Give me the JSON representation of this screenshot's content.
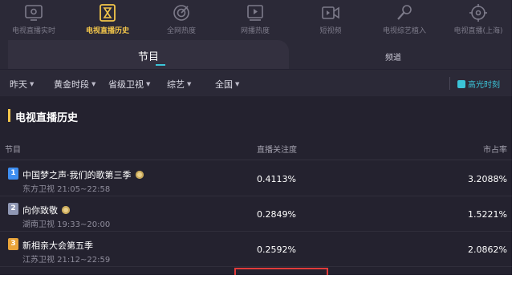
{
  "nav": {
    "items": [
      {
        "label": "电视直播实时",
        "icon": "tv-icon"
      },
      {
        "label": "电视直播历史",
        "icon": "hourglass-icon",
        "active": true
      },
      {
        "label": "全网热度",
        "icon": "target-icon"
      },
      {
        "label": "网播热度",
        "icon": "web-player-icon"
      },
      {
        "label": "短视频",
        "icon": "video-icon"
      },
      {
        "label": "电视综艺植入",
        "icon": "microphone-icon"
      },
      {
        "label": "电视直播(上海)",
        "icon": "crosshair-icon"
      }
    ]
  },
  "tabs": {
    "program": "节目",
    "channel": "频道"
  },
  "filters": {
    "date": "昨天",
    "timeslot": "黄金时段",
    "channel_group": "省级卫视",
    "genre": "综艺",
    "region": "全国",
    "highlight": "高光时刻"
  },
  "section": {
    "title": "电视直播历史"
  },
  "table": {
    "headers": {
      "program": "节目",
      "attention": "直播关注度",
      "share": "市占率"
    },
    "rows": [
      {
        "rank": "1",
        "name": "中国梦之声·我们的歌第三季",
        "meta": "东方卫视 21:05~22:58",
        "attention": "0.4113%",
        "share": "3.2088%"
      },
      {
        "rank": "2",
        "name": "向你致敬",
        "meta": "湖南卫视 19:33~20:00",
        "attention": "0.2849%",
        "share": "1.5221%"
      },
      {
        "rank": "3",
        "name": "新相亲大会第五季",
        "meta": "江苏卫视 21:12~22:59",
        "attention": "0.2592%",
        "share": "2.0862%"
      }
    ]
  },
  "colors": {
    "accent": "#f3c64a",
    "cyan": "#3bc4d8",
    "background": "#24222f"
  }
}
